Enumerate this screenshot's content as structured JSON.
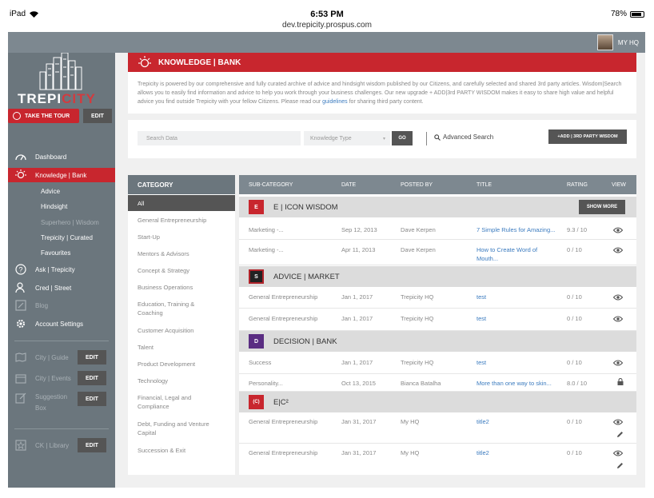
{
  "status": {
    "device": "iPad",
    "time": "6:53 PM",
    "url": "dev.trepicity.prospus.com",
    "battery": "78%"
  },
  "topbar": {
    "user_label": "MY HQ"
  },
  "sidebar": {
    "logo_main": "TREPI",
    "logo_accent": "CITY",
    "tour_label": "TAKE THE TOUR",
    "edit_label": "EDIT",
    "items": [
      {
        "label": "Dashboard"
      },
      {
        "label": "Knowledge | Bank"
      }
    ],
    "subitems": [
      {
        "label": "Advice"
      },
      {
        "label": "Hindsight"
      },
      {
        "label": "Superhero | Wisdom"
      },
      {
        "label": "Trepicity | Curated"
      },
      {
        "label": "Favourites"
      }
    ],
    "items2": [
      {
        "label": "Ask | Trepicity"
      },
      {
        "label": "Cred | Street"
      },
      {
        "label": "Blog"
      },
      {
        "label": "Account Settings"
      }
    ],
    "tools": [
      {
        "label": "City | Guide",
        "edit": "EDIT"
      },
      {
        "label": "City | Events",
        "edit": "EDIT"
      },
      {
        "label": "Suggestion Box",
        "edit": "EDIT"
      },
      {
        "label": "CK | Library",
        "edit": "EDIT"
      }
    ]
  },
  "header": {
    "title": "KNOWLEDGE | BANK",
    "intro_pre": "Trepicity is powered by our comprehensive and fully curated archive of advice and hindsight wisdom published by our Citizens, and carefully selected and shared 3rd party articles. Wisdom|Search allows you to easily find information and advice to help you work through your business challenges. Our new upgrade + ADD|3rd PARTY WISDOM makes it easy to share high value and helpful advice you find outside Trepicity with your fellow Citizens. Please read our ",
    "intro_link": "guidelines",
    "intro_post": " for sharing third party content."
  },
  "search": {
    "placeholder": "Search Data",
    "type_placeholder": "Knowledge Type",
    "go_label": "GO",
    "advanced_label": "Advanced Search",
    "add_label": "+ADD | 3RD PARTY WISDOM"
  },
  "categories": {
    "header": "CATEGORY",
    "items": [
      "All",
      "General Entrepreneurship",
      "Start-Up",
      "Mentors & Advisors",
      "Concept & Strategy",
      "Business Operations",
      "Education, Training & Coaching",
      "Customer Acquisition",
      "Talent",
      "Product Development",
      "Technology",
      "Financial, Legal and Compliance",
      "Debt, Funding and Venture Capital",
      "Succession & Exit"
    ]
  },
  "table": {
    "headers": [
      "SUB-CATEGORY",
      "DATE",
      "POSTED BY",
      "TITLE",
      "RATING",
      "VIEW"
    ],
    "show_more": "SHOW MORE",
    "groups": [
      {
        "name": "E | ICON WISDOM",
        "icon_text": "E",
        "color": "#c8262e"
      },
      {
        "name": "ADVICE | MARKET",
        "icon_text": "S",
        "color": "#b0232a"
      },
      {
        "name": "DECISION | BANK",
        "icon_text": "D",
        "color": "#5a2d82"
      },
      {
        "name": "E|C²",
        "icon_text": "(C)",
        "color": "#c8262e"
      }
    ],
    "rows": [
      [
        "Marketing -...",
        "Sep 12, 2013",
        "Dave Kerpen",
        "7 Simple Rules for Amazing...",
        "9.3 / 10"
      ],
      [
        "Marketing -...",
        "Apr 11, 2013",
        "Dave Kerpen",
        "How to Create Word of Mouth...",
        "0 / 10"
      ],
      [
        "General Entrepreneurship",
        "Jan 1, 2017",
        "Trepicity HQ",
        "test",
        "0 / 10"
      ],
      [
        "General Entrepreneurship",
        "Jan 1, 2017",
        "Trepicity HQ",
        "test",
        "0 / 10"
      ],
      [
        "Success",
        "Jan 1, 2017",
        "Trepicity HQ",
        "test",
        "0 / 10"
      ],
      [
        "Personality...",
        "Oct 13, 2015",
        "Bianca Batalha",
        "More than one way to skin...",
        "8.0 / 10"
      ],
      [
        "General Entrepreneurship",
        "Jan 31, 2017",
        "My HQ",
        "title2",
        "0 / 10"
      ],
      [
        "General Entrepreneurship",
        "Jan 31, 2017",
        "My HQ",
        "title2",
        "0 / 10"
      ]
    ]
  },
  "colors": {
    "accent": "#c8262e",
    "sidebar": "#6b767d",
    "link": "#3b7bbf"
  }
}
